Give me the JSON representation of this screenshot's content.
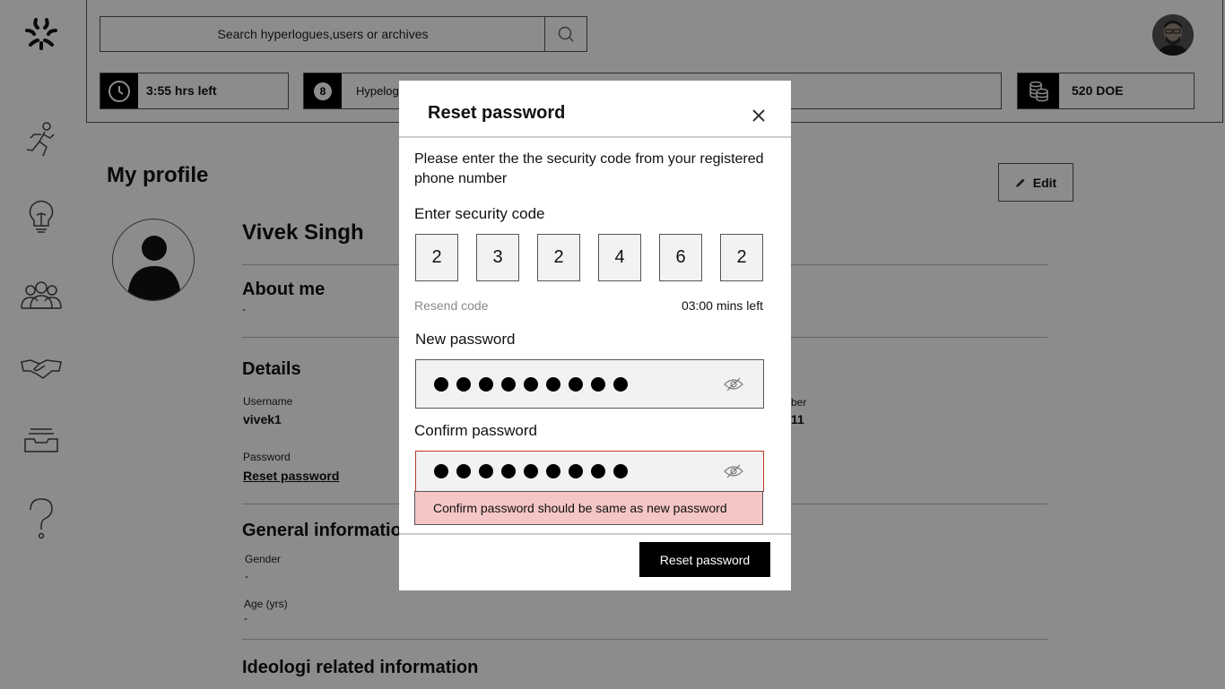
{
  "search": {
    "placeholder": "Search hyperlogues,users or archives"
  },
  "stats": {
    "time_left": "3:55 hrs left",
    "hyperlogues_count": "8",
    "hyperlogues_label": "Hypelog",
    "doe_balance": "520 DOE"
  },
  "profile": {
    "page_title": "My profile",
    "edit_label": "Edit",
    "name": "Vivek Singh",
    "about_title": "About me",
    "about_value": "-",
    "details_title": "Details",
    "username_label": "Username",
    "username_value": "vivek1",
    "partial_label": "ber",
    "partial_value": "11",
    "password_label": "Password",
    "reset_password_link": "Reset password",
    "general_title": "General informatio",
    "gender_label": "Gender",
    "gender_value": "-",
    "age_label": "Age (yrs)",
    "age_value": "-",
    "ideologi_title": "Ideologi related information"
  },
  "modal": {
    "title": "Reset password",
    "instruction": "Please enter the the security code from your registered phone number",
    "code_label": "Enter security code",
    "code_digits": [
      "2",
      "3",
      "2",
      "4",
      "6",
      "2"
    ],
    "resend_label": "Resend code",
    "timer": "03:00 mins left",
    "new_password_label": "New password",
    "confirm_password_label": "Confirm password",
    "error_message": "Confirm password should be same as new password",
    "submit_label": "Reset password"
  },
  "colors": {
    "overlay": "rgba(0,0,0,0.45)",
    "error_bg": "#f5c6c6",
    "error_border": "#c0392b"
  }
}
